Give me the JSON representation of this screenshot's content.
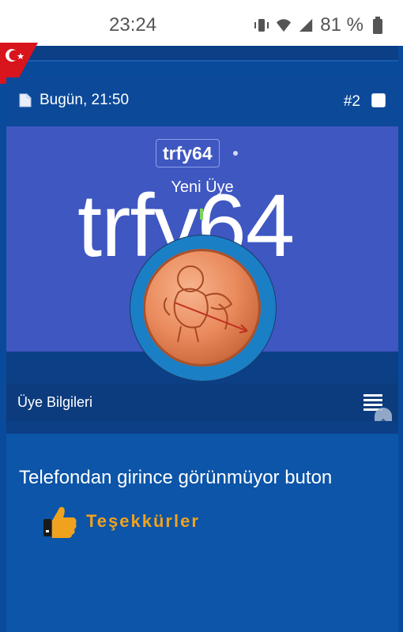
{
  "status_bar": {
    "time": "23:24",
    "battery": "81 %"
  },
  "post": {
    "date": "Bugün, 21:50",
    "number": "#2",
    "username": "trfy64",
    "user_title": "Yeni Üye",
    "banner_name": "trfy64"
  },
  "info_bar": {
    "label": "Üye Bilgileri"
  },
  "content": {
    "message": "Telefondan girince görünmüyor buton",
    "thanks_label": "Teşekkürler"
  },
  "colors": {
    "background": "#0a4a9a",
    "profile_bg": "#3f57c1",
    "thanks": "#f0a21e"
  }
}
